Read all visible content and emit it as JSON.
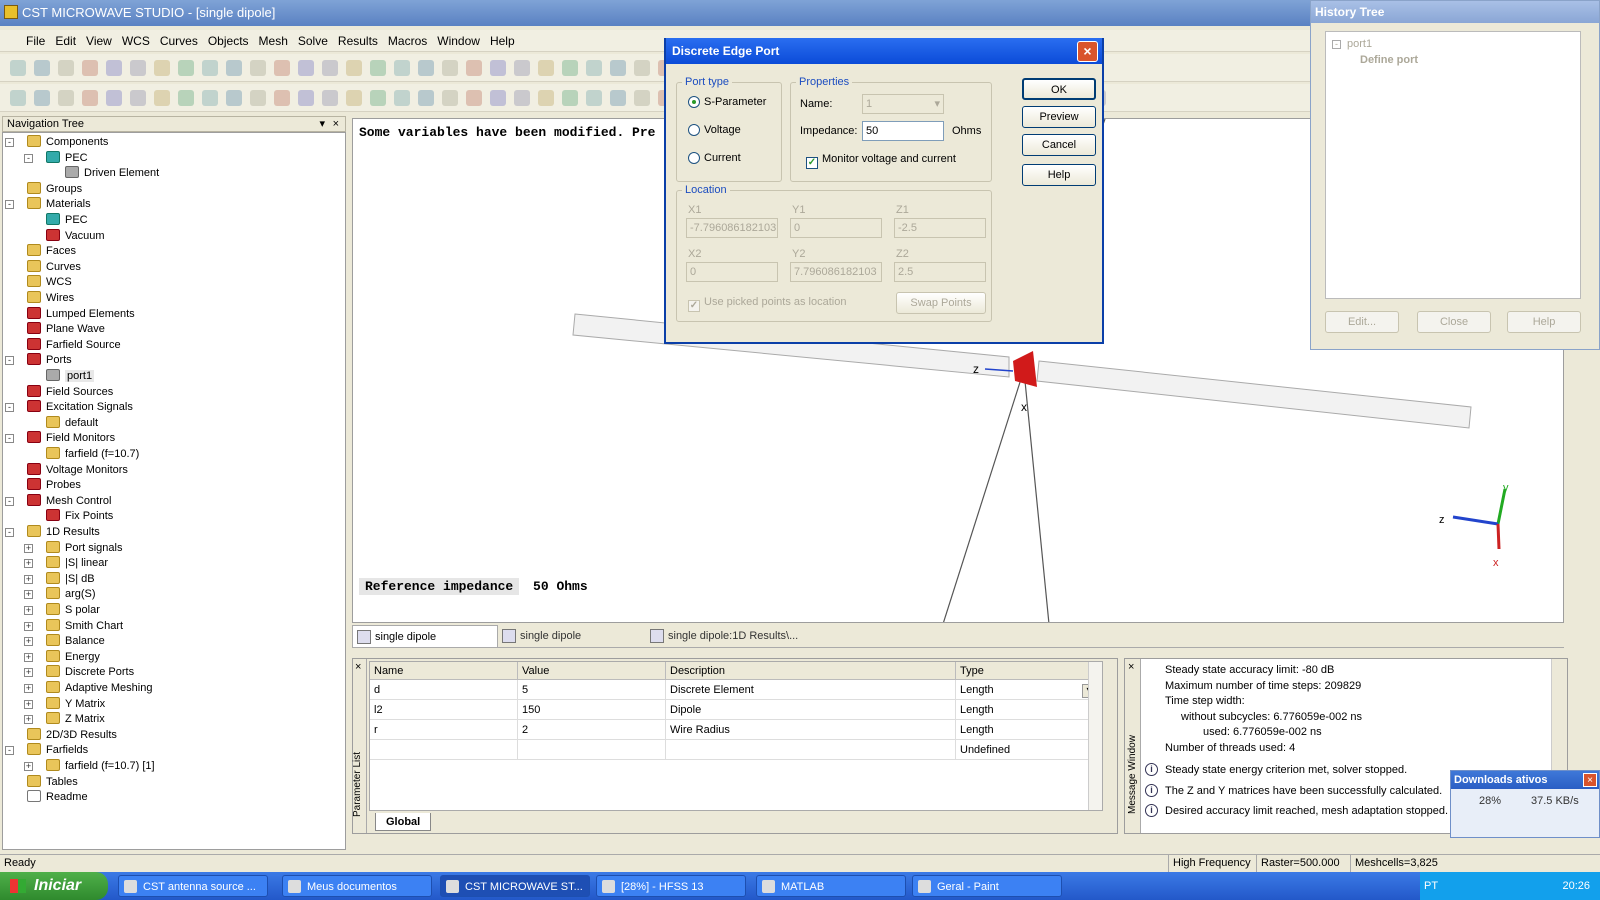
{
  "window": {
    "title": "CST MICROWAVE STUDIO - [single dipole]"
  },
  "menu": [
    "File",
    "Edit",
    "View",
    "WCS",
    "Curves",
    "Objects",
    "Mesh",
    "Solve",
    "Results",
    "Macros",
    "Window",
    "Help"
  ],
  "nav": {
    "header": "Navigation Tree",
    "items": [
      {
        "label": "Components",
        "level": 0,
        "exp": "-",
        "icon": "folder"
      },
      {
        "label": "PEC",
        "level": 1,
        "exp": "-",
        "icon": "teal"
      },
      {
        "label": "Driven Element",
        "level": 2,
        "exp": "",
        "icon": "gray"
      },
      {
        "label": "Groups",
        "level": 0,
        "exp": "",
        "icon": "folder"
      },
      {
        "label": "Materials",
        "level": 0,
        "exp": "-",
        "icon": "folder"
      },
      {
        "label": "PEC",
        "level": 1,
        "exp": "",
        "icon": "teal"
      },
      {
        "label": "Vacuum",
        "level": 1,
        "exp": "",
        "icon": "red"
      },
      {
        "label": "Faces",
        "level": 0,
        "exp": "",
        "icon": "folder"
      },
      {
        "label": "Curves",
        "level": 0,
        "exp": "",
        "icon": "folder"
      },
      {
        "label": "WCS",
        "level": 0,
        "exp": "",
        "icon": "folder"
      },
      {
        "label": "Wires",
        "level": 0,
        "exp": "",
        "icon": "folder"
      },
      {
        "label": "Lumped Elements",
        "level": 0,
        "exp": "",
        "icon": "red"
      },
      {
        "label": "Plane Wave",
        "level": 0,
        "exp": "",
        "icon": "red"
      },
      {
        "label": "Farfield Source",
        "level": 0,
        "exp": "",
        "icon": "red"
      },
      {
        "label": "Ports",
        "level": 0,
        "exp": "-",
        "icon": "red"
      },
      {
        "label": "port1",
        "level": 1,
        "exp": "",
        "icon": "gray"
      },
      {
        "label": "Field Sources",
        "level": 0,
        "exp": "",
        "icon": "red"
      },
      {
        "label": "Excitation Signals",
        "level": 0,
        "exp": "-",
        "icon": "red"
      },
      {
        "label": "default",
        "level": 1,
        "exp": "",
        "icon": "folder"
      },
      {
        "label": "Field Monitors",
        "level": 0,
        "exp": "-",
        "icon": "red"
      },
      {
        "label": "farfield (f=10.7)",
        "level": 1,
        "exp": "",
        "icon": "folder"
      },
      {
        "label": "Voltage Monitors",
        "level": 0,
        "exp": "",
        "icon": "red"
      },
      {
        "label": "Probes",
        "level": 0,
        "exp": "",
        "icon": "red"
      },
      {
        "label": "Mesh Control",
        "level": 0,
        "exp": "-",
        "icon": "red"
      },
      {
        "label": "Fix Points",
        "level": 1,
        "exp": "",
        "icon": "red"
      },
      {
        "label": "1D Results",
        "level": 0,
        "exp": "-",
        "icon": "folder"
      },
      {
        "label": "Port signals",
        "level": 1,
        "exp": "+",
        "icon": "folder"
      },
      {
        "label": "|S| linear",
        "level": 1,
        "exp": "+",
        "icon": "folder"
      },
      {
        "label": "|S| dB",
        "level": 1,
        "exp": "+",
        "icon": "folder"
      },
      {
        "label": "arg(S)",
        "level": 1,
        "exp": "+",
        "icon": "folder"
      },
      {
        "label": "S polar",
        "level": 1,
        "exp": "+",
        "icon": "folder"
      },
      {
        "label": "Smith Chart",
        "level": 1,
        "exp": "+",
        "icon": "folder"
      },
      {
        "label": "Balance",
        "level": 1,
        "exp": "+",
        "icon": "folder"
      },
      {
        "label": "Energy",
        "level": 1,
        "exp": "+",
        "icon": "folder"
      },
      {
        "label": "Discrete Ports",
        "level": 1,
        "exp": "+",
        "icon": "folder"
      },
      {
        "label": "Adaptive Meshing",
        "level": 1,
        "exp": "+",
        "icon": "folder"
      },
      {
        "label": "Y Matrix",
        "level": 1,
        "exp": "+",
        "icon": "folder"
      },
      {
        "label": "Z Matrix",
        "level": 1,
        "exp": "+",
        "icon": "folder"
      },
      {
        "label": "2D/3D Results",
        "level": 0,
        "exp": "",
        "icon": "folder"
      },
      {
        "label": "Farfields",
        "level": 0,
        "exp": "-",
        "icon": "folder"
      },
      {
        "label": "farfield (f=10.7) [1]",
        "level": 1,
        "exp": "+",
        "icon": "folder"
      },
      {
        "label": "Tables",
        "level": 0,
        "exp": "",
        "icon": "folder"
      },
      {
        "label": "Readme",
        "level": 0,
        "exp": "",
        "icon": "doc"
      }
    ]
  },
  "viewport": {
    "message": "Some variables have been modified. Pre",
    "ref_label": "Reference impedance",
    "ref_value": "50 Ohms",
    "axis_z": "z",
    "axis_x": "x",
    "triad": {
      "z": "z",
      "y": "y",
      "x": "x"
    }
  },
  "doc_tabs": [
    "single dipole",
    "single dipole",
    "single dipole:1D Results\\..."
  ],
  "params": {
    "side_label": "Parameter List",
    "headers": [
      "Name",
      "Value",
      "Description",
      "Type"
    ],
    "rows": [
      [
        "d",
        "5",
        "Discrete Element",
        "Length"
      ],
      [
        "l2",
        "150",
        "Dipole",
        "Length"
      ],
      [
        "r",
        "2",
        "Wire Radius",
        "Length"
      ],
      [
        "",
        "",
        "",
        "Undefined"
      ]
    ],
    "tab": "Global"
  },
  "messages": {
    "side_label": "Message Window",
    "plain": [
      "Steady state accuracy limit: -80 dB",
      "Maximum number of time steps: 209829",
      "Time step width:",
      "without subcycles: 6.776059e-002 ns",
      "used: 6.776059e-002 ns",
      "Number of threads used: 4"
    ],
    "info": [
      "Steady state energy criterion met, solver stopped.",
      "The Z and Y matrices have been successfully calculated.",
      "Desired accuracy limit reached, mesh adaptation stopped."
    ]
  },
  "status": {
    "left": "Ready",
    "mode": "High Frequency",
    "raster": "Raster=500.000",
    "mesh": "Meshcells=3,825"
  },
  "taskbar": {
    "start": "Iniciar",
    "tasks": [
      "CST antenna source ...",
      "Meus documentos",
      "CST MICROWAVE ST...",
      "[28%] - HFSS 13",
      "MATLAB",
      "Geral - Paint"
    ],
    "lang": "PT",
    "clock": "20:26"
  },
  "dialog": {
    "title": "Discrete Edge Port",
    "port_type_label": "Port type",
    "port_types": [
      "S-Parameter",
      "Voltage",
      "Current"
    ],
    "properties_label": "Properties",
    "name_label": "Name:",
    "name_value": "1",
    "impedance_label": "Impedance:",
    "impedance_value": "50",
    "impedance_unit": "Ohms",
    "monitor_label": "Monitor voltage and current",
    "location_label": "Location",
    "x1_label": "X1",
    "x1": "-7.796086182103",
    "y1_label": "Y1",
    "y1": "0",
    "z1_label": "Z1",
    "z1": "-2.5",
    "x2_label": "X2",
    "x2": "0",
    "y2_label": "Y2",
    "y2": "7.796086182103",
    "z2_label": "Z2",
    "z2": "2.5",
    "use_picked_label": "Use picked points as location",
    "swap_label": "Swap Points",
    "buttons": [
      "OK",
      "Preview",
      "Cancel",
      "Help"
    ]
  },
  "history": {
    "title": "History Tree",
    "root": "port1",
    "child": "Define port",
    "buttons": [
      "Edit...",
      "Close",
      "Help"
    ]
  },
  "downloads": {
    "title": "Downloads ativos",
    "percent": "28%",
    "speed": "37.5 KB/s"
  },
  "colors": {
    "accent": "#0B4BD8",
    "port_red": "#D11A1A",
    "triad_z": "#2244CC",
    "triad_y": "#22AA22",
    "triad_x": "#CC2222"
  }
}
